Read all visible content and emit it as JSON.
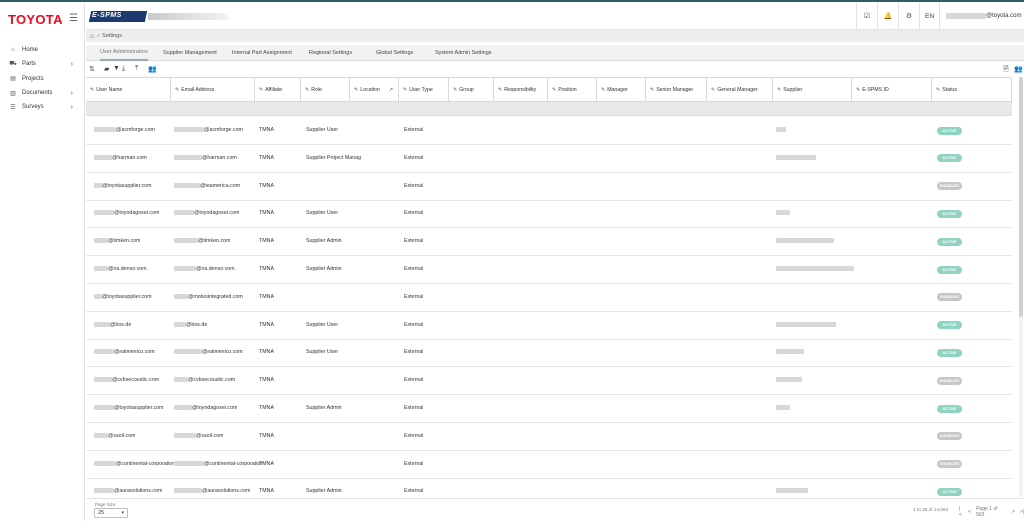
{
  "app": {
    "logo_text": "TOYOTA",
    "brand_text": "E-SPMS",
    "language": "EN",
    "user_email_suffix": "@toyota.com"
  },
  "colors": {
    "toyota_red": "#eb0a1e",
    "active_badge": "#8fd4c1",
    "disabled_badge": "#c7c7c7",
    "brand_navy": "#1d3a6e"
  },
  "sidebar": {
    "items": [
      {
        "label": "Home",
        "icon": "home-icon",
        "has_chevron": false
      },
      {
        "label": "Parts",
        "icon": "car-icon",
        "has_chevron": true
      },
      {
        "label": "Projects",
        "icon": "folder-icon",
        "has_chevron": false
      },
      {
        "label": "Documents",
        "icon": "document-icon",
        "has_chevron": true
      },
      {
        "label": "Surveys",
        "icon": "list-icon",
        "has_chevron": true
      }
    ]
  },
  "breadcrumb": {
    "home_icon": "home-icon",
    "current": "Settings"
  },
  "tabs": [
    {
      "label": "User Administration",
      "active": true
    },
    {
      "label": "Supplier Management",
      "active": false
    },
    {
      "label": "Internal Part Assignment",
      "active": false
    },
    {
      "label": "Regional Settings",
      "active": false
    },
    {
      "label": "Global Settings",
      "active": false
    },
    {
      "label": "System Admin Settings",
      "active": false
    }
  ],
  "columns": [
    "User Name",
    "Email Address",
    "Affiliate",
    "Role",
    "Location",
    "User Type",
    "Group",
    "Responsibility",
    "Position",
    "Manager",
    "Senior Manager",
    "General Manager",
    "Supplier",
    "E-SPMS ID",
    "Status"
  ],
  "rows": [
    {
      "user": "@acmforge.com",
      "email": "@acmforge.com",
      "affiliate": "TMNA",
      "role": "Supplier User",
      "type": "External",
      "status": "ACTIVE"
    },
    {
      "user": "@harman.com",
      "email": "@harman.com",
      "affiliate": "TMNA",
      "role": "Supplier Project Manag",
      "type": "External",
      "status": "ACTIVE"
    },
    {
      "user": "@toyotasupplier.com",
      "email": "@teamerica.com",
      "affiliate": "TMNA",
      "role": "",
      "type": "External",
      "status": "DISABLED"
    },
    {
      "user": "@toyodagosei.com",
      "email": "@toyodagosei.com",
      "affiliate": "TMNA",
      "role": "Supplier User",
      "type": "External",
      "status": "ACTIVE"
    },
    {
      "user": "@timken.com",
      "email": "@timken.com",
      "affiliate": "TMNA",
      "role": "Supplier Admin",
      "type": "External",
      "status": "ACTIVE"
    },
    {
      "user": "@na.denso.com",
      "email": "@na.denso.com",
      "affiliate": "TMNA",
      "role": "Supplier Admin",
      "type": "External",
      "status": "ACTIVE"
    },
    {
      "user": "@toyotasupplier.com",
      "email": "@motusintegrated.com",
      "affiliate": "TMNA",
      "role": "",
      "type": "External",
      "status": "DISABLED"
    },
    {
      "user": "@bos.de",
      "email": "@bos.de",
      "affiliate": "TMNA",
      "role": "Supplier User",
      "type": "External",
      "status": "ACTIVE"
    },
    {
      "user": "@nalmexico.com",
      "email": "@nalmexico.com",
      "affiliate": "TMNA",
      "role": "Supplier User",
      "type": "External",
      "status": "ACTIVE"
    },
    {
      "user": "@cvbsecoustic.com",
      "email": "@cvbsecoustic.com",
      "affiliate": "TMNA",
      "role": "",
      "type": "External",
      "status": "DISABLED"
    },
    {
      "user": "@toyotasupplier.com",
      "email": "@toyodagosei.com",
      "affiliate": "TMNA",
      "role": "Supplier Admin",
      "type": "External",
      "status": "ACTIVE"
    },
    {
      "user": "@ssoil.com",
      "email": "@ssoil.com",
      "affiliate": "TMNA",
      "role": "",
      "type": "External",
      "status": "DISABLED"
    },
    {
      "user": "@continental-corporation",
      "email": "@continental-corporation",
      "affiliate": "TMNA",
      "role": "",
      "type": "External",
      "status": "DISABLED"
    },
    {
      "user": "@aurasolutions.com",
      "email": "@aurasolutions.com",
      "affiliate": "TMNA",
      "role": "Supplier Admin",
      "type": "External",
      "status": "ACTIVE"
    }
  ],
  "footer": {
    "page_size_label": "Page Size",
    "page_size_value": "25",
    "range_text": "1 to 25 of 14,063",
    "page_text": "Page 1 of 563"
  }
}
